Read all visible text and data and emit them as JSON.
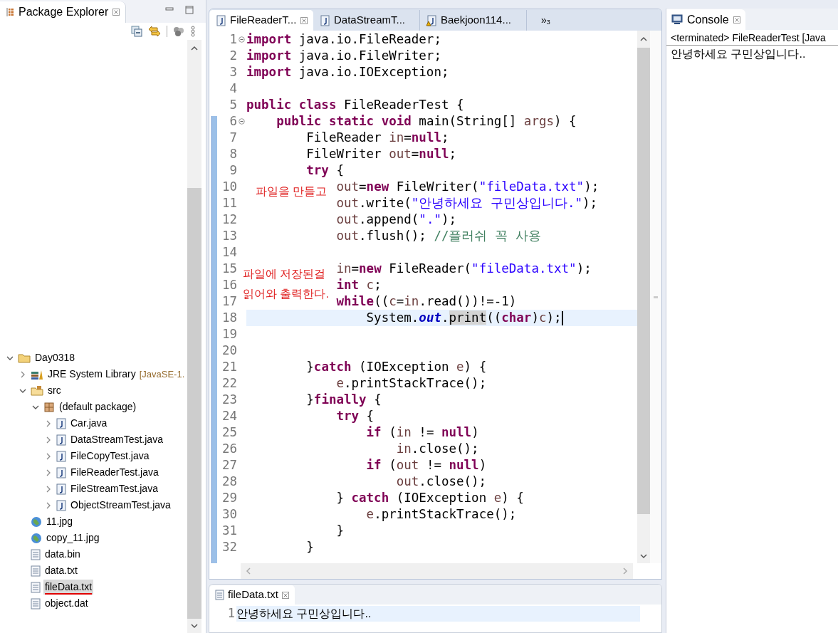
{
  "package_explorer": {
    "title": "Package Explorer",
    "tree": [
      {
        "label": "Day0318",
        "kind": "project",
        "expanded": true,
        "selected": false,
        "underlined": false,
        "children": [
          {
            "label": "JRE System Library",
            "decoration": "[JavaSE-1.",
            "kind": "library",
            "expanded": false,
            "selected": false,
            "underlined": false
          },
          {
            "label": "src",
            "kind": "source-folder",
            "expanded": true,
            "selected": false,
            "underlined": false,
            "children": [
              {
                "label": "(default package)",
                "kind": "package",
                "expanded": true,
                "selected": false,
                "underlined": false,
                "children": [
                  {
                    "label": "Car.java",
                    "kind": "java",
                    "expanded": false,
                    "selected": false,
                    "underlined": false
                  },
                  {
                    "label": "DataStreamTest.java",
                    "kind": "java",
                    "expanded": false,
                    "selected": false,
                    "underlined": false
                  },
                  {
                    "label": "FileCopyTest.java",
                    "kind": "java",
                    "expanded": false,
                    "selected": false,
                    "underlined": false
                  },
                  {
                    "label": "FileReaderTest.java",
                    "kind": "java",
                    "expanded": false,
                    "selected": false,
                    "underlined": false
                  },
                  {
                    "label": "FileStreamTest.java",
                    "kind": "java",
                    "expanded": false,
                    "selected": false,
                    "underlined": false
                  },
                  {
                    "label": "ObjectStreamTest.java",
                    "kind": "java",
                    "expanded": false,
                    "selected": false,
                    "underlined": false
                  }
                ]
              }
            ]
          },
          {
            "label": "11.jpg",
            "kind": "image",
            "selected": false,
            "underlined": false
          },
          {
            "label": "copy_11.jpg",
            "kind": "image",
            "selected": false,
            "underlined": false
          },
          {
            "label": "data.bin",
            "kind": "file",
            "selected": false,
            "underlined": false
          },
          {
            "label": "data.txt",
            "kind": "file",
            "selected": false,
            "underlined": false
          },
          {
            "label": "fileData.txt",
            "kind": "file",
            "selected": true,
            "underlined": true
          },
          {
            "label": "object.dat",
            "kind": "file",
            "selected": false,
            "underlined": false
          }
        ]
      }
    ]
  },
  "editor": {
    "tabs": [
      {
        "label": "FileReaderT...",
        "selected": true,
        "warning": false
      },
      {
        "label": "DataStreamT...",
        "selected": false,
        "warning": false
      },
      {
        "label": "Baekjoon114...",
        "selected": false,
        "warning": true
      }
    ],
    "overflow": {
      "label": "»",
      "count": "3"
    },
    "lines": [
      {
        "number": "1",
        "fold": true,
        "current": false,
        "tokens": [
          {
            "kind": "kw",
            "text": "import"
          },
          {
            "kind": "p",
            "text": " java.io.FileReader;"
          }
        ]
      },
      {
        "number": "2",
        "fold": false,
        "current": false,
        "tokens": [
          {
            "kind": "kw",
            "text": "import"
          },
          {
            "kind": "p",
            "text": " java.io.FileWriter;"
          }
        ]
      },
      {
        "number": "3",
        "fold": false,
        "current": false,
        "tokens": [
          {
            "kind": "kw",
            "text": "import"
          },
          {
            "kind": "p",
            "text": " java.io.IOException;"
          }
        ]
      },
      {
        "number": "4",
        "fold": false,
        "current": false
      },
      {
        "number": "5",
        "fold": false,
        "current": false,
        "tokens": [
          {
            "kind": "kw",
            "text": "public class"
          },
          {
            "kind": "p",
            "text": " FileReaderTest {"
          }
        ]
      },
      {
        "number": "6",
        "fold": true,
        "current": false,
        "tokens": [
          {
            "kind": "kw",
            "text": "    public static void"
          },
          {
            "kind": "p",
            "text": " main(String[] "
          },
          {
            "kind": "v",
            "text": "args"
          },
          {
            "kind": "p",
            "text": ") {"
          }
        ]
      },
      {
        "number": "7",
        "fold": false,
        "current": false,
        "tokens": [
          {
            "kind": "p",
            "text": "        FileReader "
          },
          {
            "kind": "v",
            "text": "in"
          },
          {
            "kind": "p",
            "text": "="
          },
          {
            "kind": "kw",
            "text": "null"
          },
          {
            "kind": "p",
            "text": ";"
          }
        ]
      },
      {
        "number": "8",
        "fold": false,
        "current": false,
        "tokens": [
          {
            "kind": "p",
            "text": "        FileWriter "
          },
          {
            "kind": "v",
            "text": "out"
          },
          {
            "kind": "p",
            "text": "="
          },
          {
            "kind": "kw",
            "text": "null"
          },
          {
            "kind": "p",
            "text": ";"
          }
        ]
      },
      {
        "number": "9",
        "fold": false,
        "current": false,
        "tokens": [
          {
            "kind": "kw",
            "text": "        try"
          },
          {
            "kind": "p",
            "text": " {"
          }
        ]
      },
      {
        "number": "10",
        "fold": false,
        "current": false,
        "tokens": [
          {
            "kind": "v",
            "text": "            out"
          },
          {
            "kind": "p",
            "text": "="
          },
          {
            "kind": "kw",
            "text": "new"
          },
          {
            "kind": "p",
            "text": " FileWriter("
          },
          {
            "kind": "s",
            "text": "\"fileData.txt\""
          },
          {
            "kind": "p",
            "text": ");"
          }
        ]
      },
      {
        "number": "11",
        "fold": false,
        "current": false,
        "tokens": [
          {
            "kind": "v",
            "text": "            out"
          },
          {
            "kind": "p",
            "text": ".write("
          },
          {
            "kind": "s",
            "text": "\"안녕하세요 구민상입니다.\""
          },
          {
            "kind": "p",
            "text": ");"
          }
        ]
      },
      {
        "number": "12",
        "fold": false,
        "current": false,
        "tokens": [
          {
            "kind": "v",
            "text": "            out"
          },
          {
            "kind": "p",
            "text": ".append("
          },
          {
            "kind": "s",
            "text": "\".\""
          },
          {
            "kind": "p",
            "text": ");"
          }
        ]
      },
      {
        "number": "13",
        "fold": false,
        "current": false,
        "tokens": [
          {
            "kind": "v",
            "text": "            out"
          },
          {
            "kind": "p",
            "text": ".flush(); "
          },
          {
            "kind": "c",
            "text": "//플러쉬 꼭 사용"
          }
        ]
      },
      {
        "number": "14",
        "fold": false,
        "current": false
      },
      {
        "number": "15",
        "fold": false,
        "current": false,
        "tokens": [
          {
            "kind": "v",
            "text": "            in"
          },
          {
            "kind": "p",
            "text": "="
          },
          {
            "kind": "kw",
            "text": "new"
          },
          {
            "kind": "p",
            "text": " FileReader("
          },
          {
            "kind": "s",
            "text": "\"fileData.txt\""
          },
          {
            "kind": "p",
            "text": ");"
          }
        ]
      },
      {
        "number": "16",
        "fold": false,
        "current": false,
        "tokens": [
          {
            "kind": "kw",
            "text": "            int"
          },
          {
            "kind": "v",
            "text": " c"
          },
          {
            "kind": "p",
            "text": ";"
          }
        ]
      },
      {
        "number": "17",
        "fold": false,
        "current": false,
        "tokens": [
          {
            "kind": "kw",
            "text": "            while"
          },
          {
            "kind": "p",
            "text": "(("
          },
          {
            "kind": "v",
            "text": "c"
          },
          {
            "kind": "p",
            "text": "="
          },
          {
            "kind": "v",
            "text": "in"
          },
          {
            "kind": "p",
            "text": ".read())!=-1)"
          }
        ]
      },
      {
        "number": "18",
        "fold": false,
        "current": true,
        "tokens": [
          {
            "kind": "p",
            "text": "                System."
          },
          {
            "kind": "f",
            "text": "out"
          },
          {
            "kind": "p",
            "text": "."
          },
          {
            "kind": "m",
            "text": "print"
          },
          {
            "kind": "p",
            "text": "(("
          },
          {
            "kind": "kw",
            "text": "char"
          },
          {
            "kind": "p",
            "text": ")"
          },
          {
            "kind": "v",
            "text": "c"
          },
          {
            "kind": "p",
            "text": ");"
          }
        ]
      },
      {
        "number": "19",
        "fold": false,
        "current": false
      },
      {
        "number": "20",
        "fold": false,
        "current": false
      },
      {
        "number": "21",
        "fold": false,
        "current": false,
        "tokens": [
          {
            "kind": "p",
            "text": "        }"
          },
          {
            "kind": "kw",
            "text": "catch"
          },
          {
            "kind": "p",
            "text": " (IOException "
          },
          {
            "kind": "v",
            "text": "e"
          },
          {
            "kind": "p",
            "text": ") {"
          }
        ]
      },
      {
        "number": "22",
        "fold": false,
        "current": false,
        "tokens": [
          {
            "kind": "v",
            "text": "            e"
          },
          {
            "kind": "p",
            "text": ".printStackTrace();"
          }
        ]
      },
      {
        "number": "23",
        "fold": false,
        "current": false,
        "tokens": [
          {
            "kind": "p",
            "text": "        }"
          },
          {
            "kind": "kw",
            "text": "finally"
          },
          {
            "kind": "p",
            "text": " {"
          }
        ]
      },
      {
        "number": "24",
        "fold": false,
        "current": false,
        "tokens": [
          {
            "kind": "kw",
            "text": "            try"
          },
          {
            "kind": "p",
            "text": " {"
          }
        ]
      },
      {
        "number": "25",
        "fold": false,
        "current": false,
        "tokens": [
          {
            "kind": "kw",
            "text": "                if"
          },
          {
            "kind": "p",
            "text": " ("
          },
          {
            "kind": "v",
            "text": "in"
          },
          {
            "kind": "p",
            "text": " != "
          },
          {
            "kind": "kw",
            "text": "null"
          },
          {
            "kind": "p",
            "text": ")"
          }
        ]
      },
      {
        "number": "26",
        "fold": false,
        "current": false,
        "tokens": [
          {
            "kind": "v",
            "text": "                    in"
          },
          {
            "kind": "p",
            "text": ".close();"
          }
        ]
      },
      {
        "number": "27",
        "fold": false,
        "current": false,
        "tokens": [
          {
            "kind": "kw",
            "text": "                if"
          },
          {
            "kind": "p",
            "text": " ("
          },
          {
            "kind": "v",
            "text": "out"
          },
          {
            "kind": "p",
            "text": " != "
          },
          {
            "kind": "kw",
            "text": "null"
          },
          {
            "kind": "p",
            "text": ")"
          }
        ]
      },
      {
        "number": "28",
        "fold": false,
        "current": false,
        "tokens": [
          {
            "kind": "v",
            "text": "                    out"
          },
          {
            "kind": "p",
            "text": ".close();"
          }
        ]
      },
      {
        "number": "29",
        "fold": false,
        "current": false,
        "tokens": [
          {
            "kind": "p",
            "text": "            } "
          },
          {
            "kind": "kw",
            "text": "catch"
          },
          {
            "kind": "p",
            "text": " (IOException "
          },
          {
            "kind": "v",
            "text": "e"
          },
          {
            "kind": "p",
            "text": ") {"
          }
        ]
      },
      {
        "number": "30",
        "fold": false,
        "current": false,
        "tokens": [
          {
            "kind": "v",
            "text": "                e"
          },
          {
            "kind": "p",
            "text": ".printStackTrace();"
          }
        ]
      },
      {
        "number": "31",
        "fold": false,
        "current": false,
        "tokens": [
          {
            "kind": "p",
            "text": "            }"
          }
        ]
      },
      {
        "number": "32",
        "fold": false,
        "current": false,
        "tokens": [
          {
            "kind": "p",
            "text": "        }"
          }
        ]
      }
    ],
    "notes": [
      "파일을 만들고",
      "파일에 저장된걸",
      "읽어와 출력한다."
    ]
  },
  "console": {
    "title": "Console",
    "header": "<terminated> FileReaderTest [Java",
    "output": "안녕하세요 구민상입니다.."
  },
  "file_editor": {
    "tab": "fileData.txt",
    "lines": [
      {
        "number": "1",
        "text": "안녕하세요 구민상입니다.."
      }
    ]
  }
}
